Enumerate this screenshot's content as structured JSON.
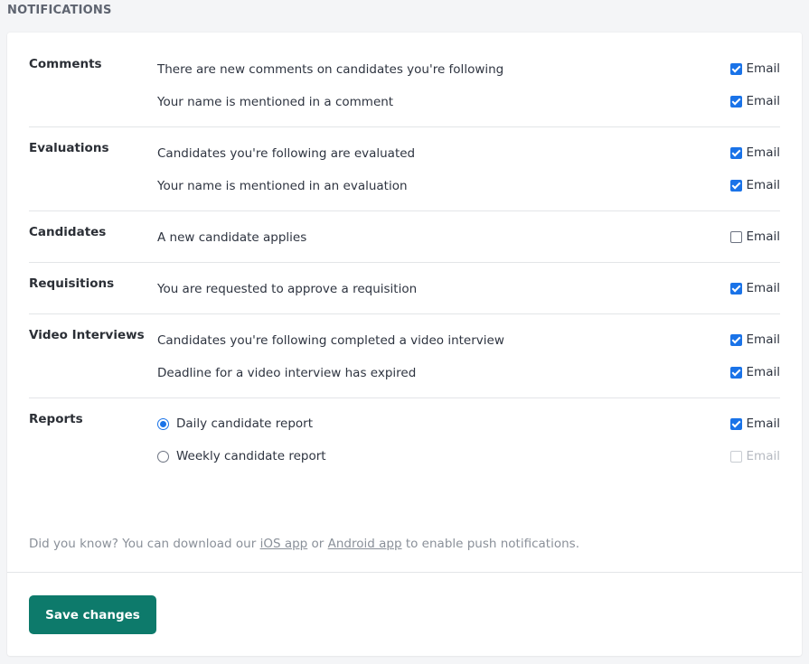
{
  "section_title": "NOTIFICATIONS",
  "colors": {
    "accent_checkbox": "#1a73e8",
    "save_button": "#0d7a6b"
  },
  "groups": [
    {
      "label": "Comments",
      "rows": [
        {
          "text": "There are new comments on candidates you're following",
          "email_label": "Email",
          "email_checked": true
        },
        {
          "text": "Your name is mentioned in a comment",
          "email_label": "Email",
          "email_checked": true
        }
      ]
    },
    {
      "label": "Evaluations",
      "rows": [
        {
          "text": "Candidates you're following are evaluated",
          "email_label": "Email",
          "email_checked": true
        },
        {
          "text": "Your name is mentioned in an evaluation",
          "email_label": "Email",
          "email_checked": true
        }
      ]
    },
    {
      "label": "Candidates",
      "rows": [
        {
          "text": "A new candidate applies",
          "email_label": "Email",
          "email_checked": false
        }
      ]
    },
    {
      "label": "Requisitions",
      "rows": [
        {
          "text": "You are requested to approve a requisition",
          "email_label": "Email",
          "email_checked": true
        }
      ]
    },
    {
      "label": "Video Interviews",
      "rows": [
        {
          "text": "Candidates you're following completed a video interview",
          "email_label": "Email",
          "email_checked": true
        },
        {
          "text": "Deadline for a video interview has expired",
          "email_label": "Email",
          "email_checked": true
        }
      ]
    },
    {
      "label": "Reports",
      "rows": [
        {
          "text": "Daily candidate report",
          "radio_selected": true,
          "email_label": "Email",
          "email_checked": true,
          "email_disabled": false
        },
        {
          "text": "Weekly candidate report",
          "radio_selected": false,
          "email_label": "Email",
          "email_checked": false,
          "email_disabled": true
        }
      ]
    }
  ],
  "note": {
    "prefix": "Did you know? You can download our ",
    "ios_link": "iOS app",
    "middle": " or ",
    "android_link": "Android app",
    "suffix": " to enable push notifications."
  },
  "save_label": "Save changes"
}
